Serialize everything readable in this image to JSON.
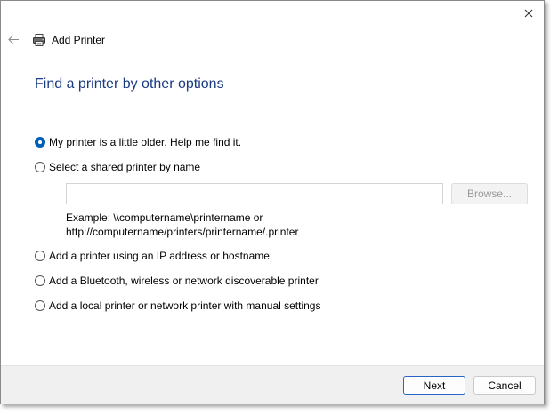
{
  "window": {
    "title": "Add Printer",
    "heading": "Find a printer by other options"
  },
  "icons": {
    "close": "close-icon",
    "back": "back-arrow-icon",
    "printer": "printer-icon"
  },
  "options": [
    {
      "label": "My printer is a little older. Help me find it.",
      "checked": true
    },
    {
      "label": "Select a shared printer by name",
      "checked": false
    },
    {
      "label": "Add a printer using an IP address or hostname",
      "checked": false
    },
    {
      "label": "Add a Bluetooth, wireless or network discoverable printer",
      "checked": false
    },
    {
      "label": "Add a local printer or network printer with manual settings",
      "checked": false
    }
  ],
  "shared_printer": {
    "value": "",
    "browse_label": "Browse...",
    "example_line1": "Example: \\\\computername\\printername or",
    "example_line2": "http://computername/printers/printername/.printer"
  },
  "footer": {
    "next_label": "Next",
    "cancel_label": "Cancel"
  },
  "colors": {
    "heading": "#1a3a84",
    "accent": "#005fb8"
  }
}
